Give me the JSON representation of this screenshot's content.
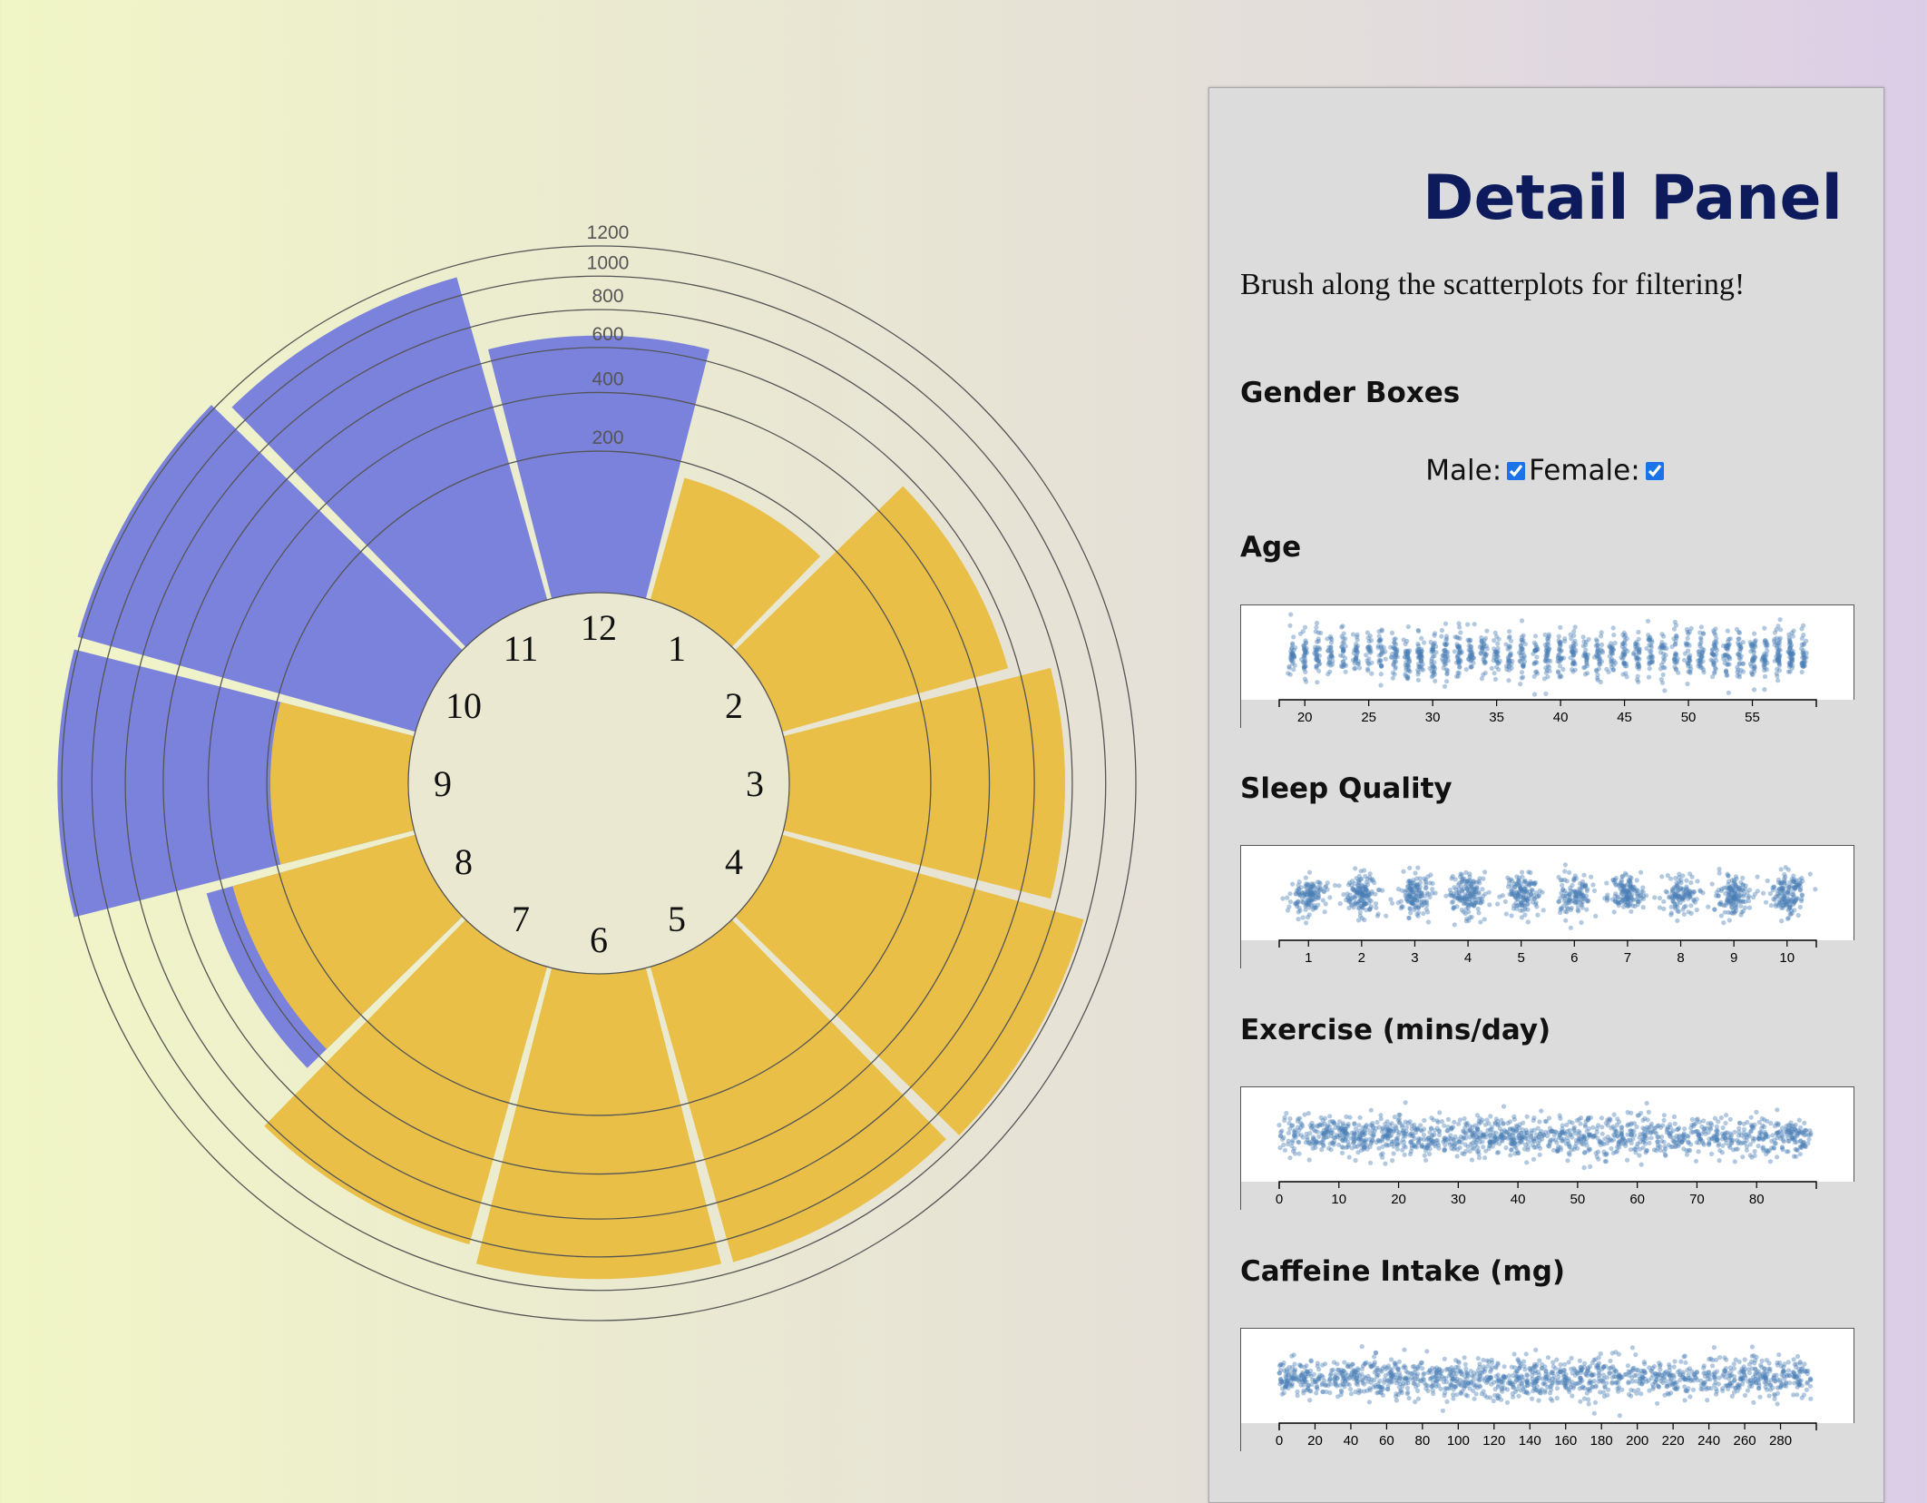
{
  "colors": {
    "male_bars": "#7b82dc",
    "female_bars": "#e9bf47",
    "clock_face": "#eae8d0",
    "grid": "#555555",
    "scatter_points": "#4a7fb4",
    "panel_title": "#0d1b5c"
  },
  "chart_data": {
    "type": "radial-bar",
    "center_labels": [
      "12",
      "1",
      "2",
      "3",
      "4",
      "5",
      "6",
      "7",
      "8",
      "9",
      "10",
      "11"
    ],
    "radial_ticks": [
      200,
      400,
      600,
      800,
      1000,
      1200
    ],
    "rlim": [
      0,
      1200
    ],
    "series": [
      {
        "hour": 12,
        "value": 660,
        "color": "blue"
      },
      {
        "hour": 1,
        "value": 160,
        "color": "yellow"
      },
      {
        "hour": 2,
        "value": 550,
        "color": "yellow"
      },
      {
        "hour": 3,
        "value": 760,
        "color": "yellow"
      },
      {
        "hour": 4,
        "value": 980,
        "color": "yellow"
      },
      {
        "hour": 5,
        "value": 940,
        "color": "yellow"
      },
      {
        "hour": 6,
        "value": 930,
        "color": "yellow"
      },
      {
        "hour": 7,
        "value": 830,
        "color": "yellow"
      },
      {
        "hour": 8,
        "value": 470,
        "color": "blue"
      },
      {
        "hour": 9,
        "value": 1230,
        "color": "blue"
      },
      {
        "hour": 10,
        "value": 1230,
        "color": "blue"
      },
      {
        "hour": 11,
        "value": 1120,
        "color": "blue"
      }
    ],
    "inner_overlay": [
      {
        "hour": 8,
        "value": 360,
        "color": "yellow"
      },
      {
        "hour": 9,
        "value": 190,
        "color": "yellow"
      }
    ],
    "mini_scatterplots": [
      {
        "title": "Age",
        "type": "scatter",
        "xlim": [
          18,
          60
        ],
        "ticks": [
          20,
          25,
          30,
          35,
          40,
          45,
          50,
          55
        ],
        "pattern": "columns-per-integer"
      },
      {
        "title": "Sleep Quality",
        "type": "scatter",
        "xlim": [
          0.45,
          10.55
        ],
        "ticks": [
          1,
          2,
          3,
          4,
          5,
          6,
          7,
          8,
          9,
          10
        ],
        "pattern": "clusters-per-integer"
      },
      {
        "title": "Exercise (mins/day)",
        "type": "scatter",
        "xlim": [
          0,
          90
        ],
        "ticks": [
          0,
          10,
          20,
          30,
          40,
          50,
          60,
          70,
          80
        ],
        "pattern": "continuous"
      },
      {
        "title": "Caffeine Intake (mg)",
        "type": "scatter",
        "xlim": [
          0,
          300
        ],
        "ticks": [
          0,
          20,
          40,
          60,
          80,
          100,
          120,
          140,
          160,
          180,
          200,
          220,
          240,
          260,
          280
        ],
        "pattern": "continuous"
      }
    ]
  },
  "panel": {
    "title": "Detail Panel",
    "instructions": "Brush along the scatterplots for filtering!",
    "gender_title": "Gender Boxes",
    "male_label": "Male:",
    "male_checked": true,
    "female_label": "Female:",
    "female_checked": true,
    "age_title": "Age",
    "sleep_title": "Sleep Quality",
    "exercise_title": "Exercise (mins/day)",
    "caffeine_title": "Caffeine Intake (mg)"
  }
}
